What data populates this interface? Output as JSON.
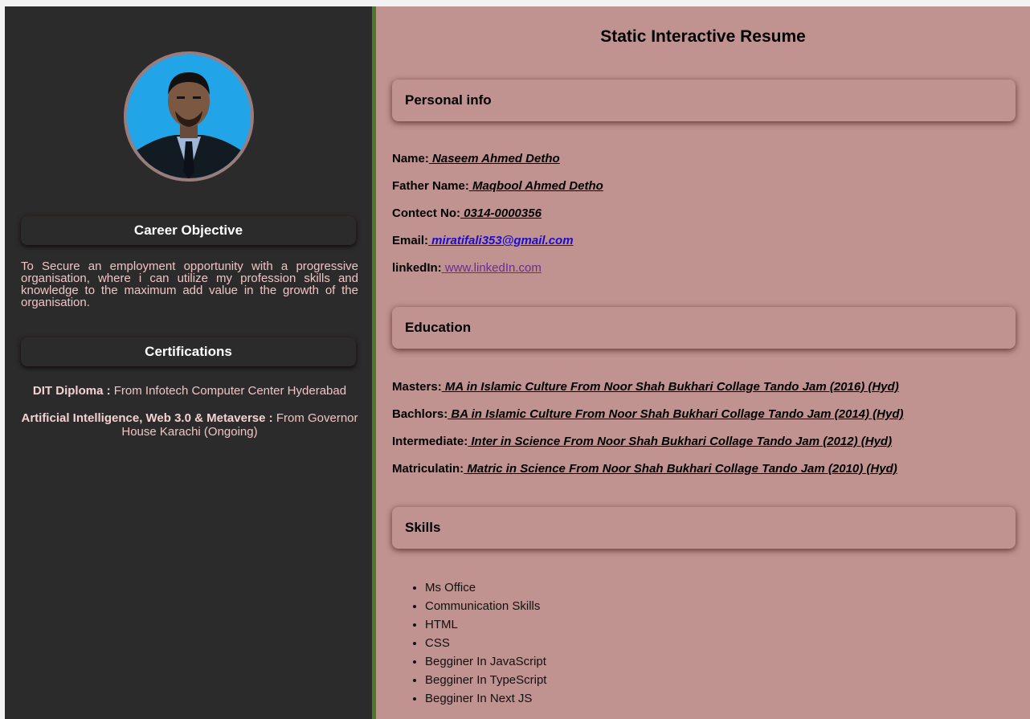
{
  "sidebar": {
    "career_heading": "Career Objective",
    "objective_text": "To Secure an employment opportunity with a progressive organisation, where i can utilize my profession skills and knowledge to the maximum add value in the growth of the organisation.",
    "certifications_heading": "Certifications",
    "certifications": [
      {
        "title": "DIT Diploma :",
        "detail": " From Infotech Computer Center Hyderabad"
      },
      {
        "title": "Artificial Intelligence, Web 3.0 & Metaverse :",
        "detail": " From Governor House Karachi (Ongoing)"
      }
    ]
  },
  "main": {
    "title": "Static Interactive Resume",
    "personal": {
      "heading": "Personal info",
      "fields": [
        {
          "label": "Name:",
          "value": " Naseem Ahmed Detho"
        },
        {
          "label": "Father Name:",
          "value": " Maqbool Ahmed Detho"
        },
        {
          "label": "Contect No:",
          "value": " 0314-0000356"
        },
        {
          "label": "Email:",
          "value": " miratifali353@gmail.com"
        },
        {
          "label": "linkedIn:",
          "value": " www.linkedIn.com"
        }
      ]
    },
    "education": {
      "heading": "Education",
      "items": [
        {
          "label": "Masters:",
          "value": " MA in Islamic Culture From Noor Shah Bukhari Collage Tando Jam (2016) (Hyd)"
        },
        {
          "label": "Bachlors:",
          "value": " BA in Islamic Culture From Noor Shah Bukhari Collage Tando Jam (2014) (Hyd)"
        },
        {
          "label": "Intermediate:",
          "value": " Inter in Science From Noor Shah Bukhari Collage Tando Jam (2012) (Hyd)"
        },
        {
          "label": "Matriculatin:",
          "value": " Matric in Science From Noor Shah Bukhari Collage Tando Jam (2010) (Hyd)"
        }
      ]
    },
    "skills": {
      "heading": "Skills",
      "items": [
        "Ms Office",
        "Communication Skills",
        "HTML",
        "CSS",
        "Begginer In JavaScript",
        "Begginer In TypeScript",
        "Begginer In Next JS"
      ]
    }
  },
  "colors": {
    "sidebar_bg": "#2b2b2b",
    "main_bg": "#c09290",
    "divider": "#4c7a2b",
    "sidebar_text": "#f0c4c4",
    "email_link": "#1a0dcf",
    "visited_link": "#6a2c8f"
  }
}
